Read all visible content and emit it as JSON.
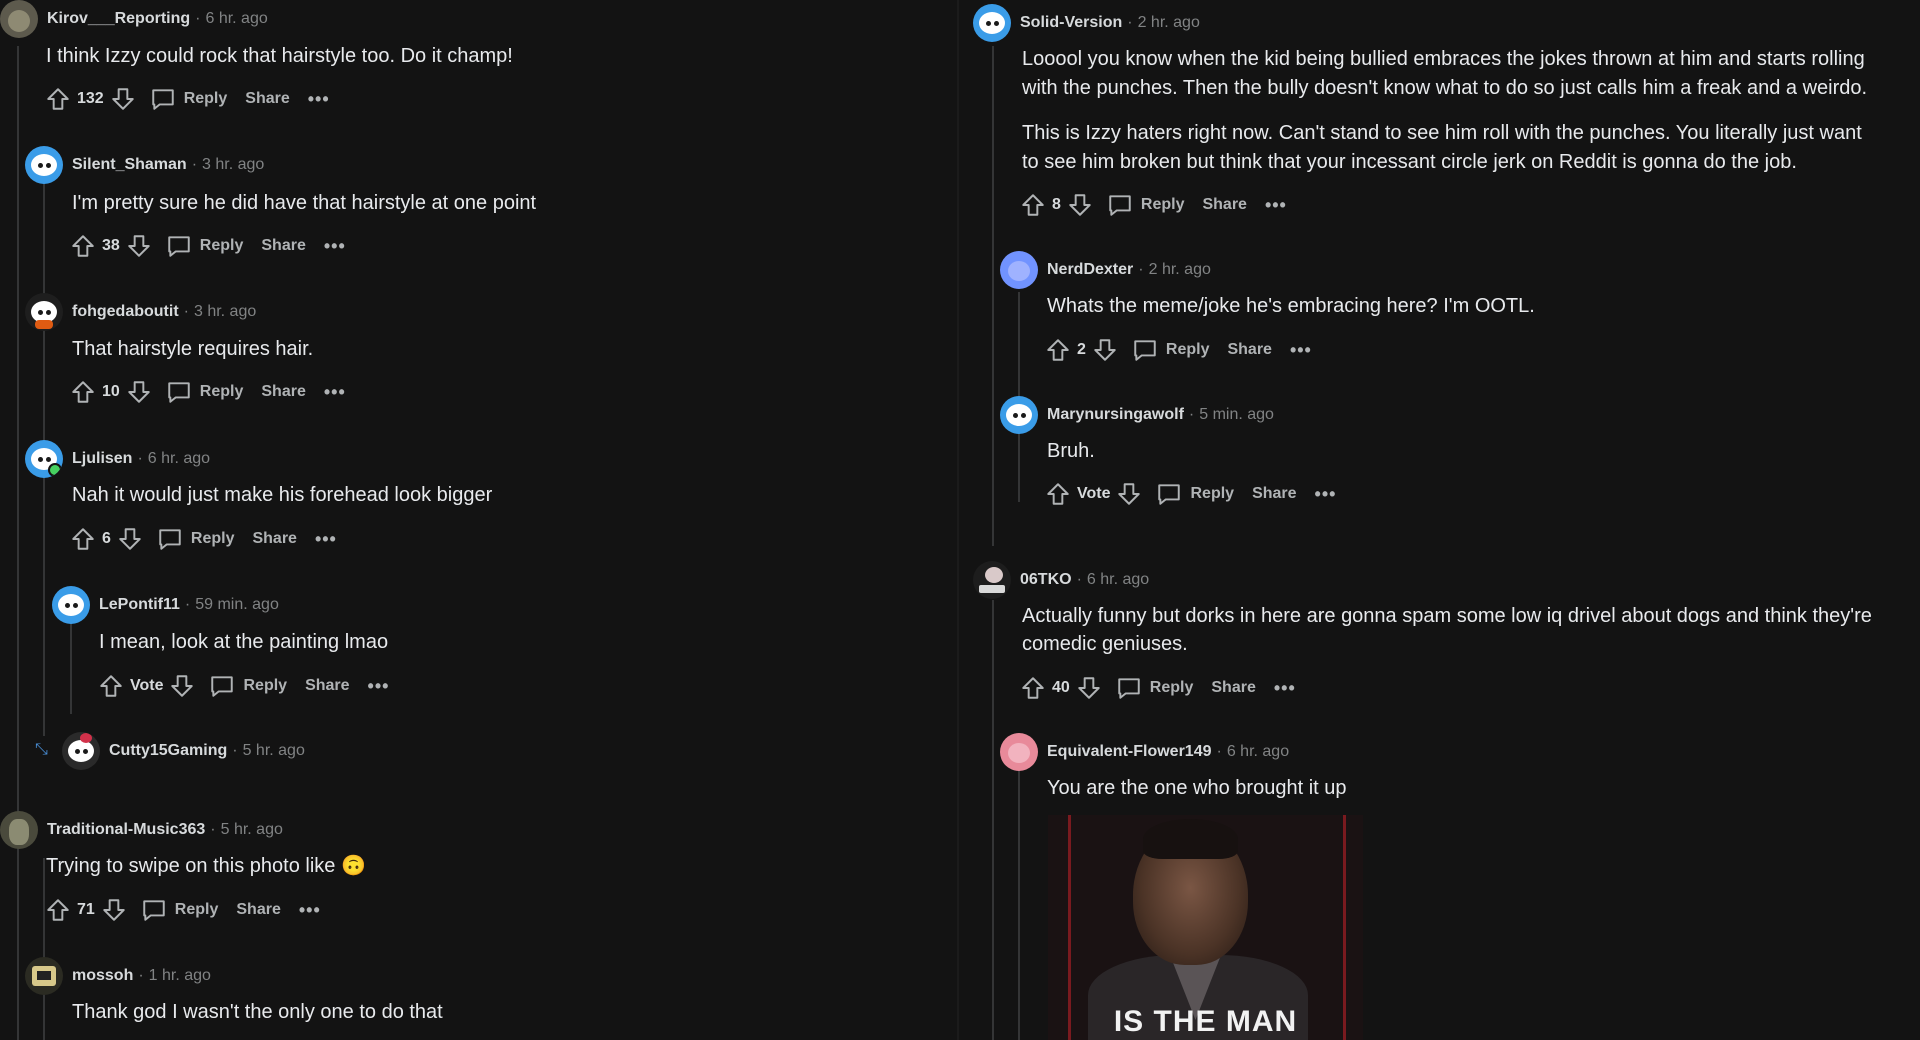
{
  "labels": {
    "reply": "Reply",
    "share": "Share",
    "more": "•••",
    "dot": "·"
  },
  "left_comments": [
    {
      "username": "Kirov___Reporting",
      "time": "6 hr. ago",
      "text": "I think Izzy could rock that hairstyle too. Do it champ!",
      "score": "132"
    },
    {
      "username": "Silent_Shaman",
      "time": "3 hr. ago",
      "text": "I'm pretty sure he did have that hairstyle at one point",
      "score": "38"
    },
    {
      "username": "fohgedaboutit",
      "time": "3 hr. ago",
      "text": "That hairstyle requires hair.",
      "score": "10"
    },
    {
      "username": "Ljulisen",
      "time": "6 hr. ago",
      "text": "Nah it would just make his forehead look bigger",
      "score": "6"
    },
    {
      "username": "LePontif11",
      "time": "59 min. ago",
      "text": "I mean, look at the painting lmao",
      "score": "Vote"
    },
    {
      "username": "Cutty15Gaming",
      "time": "5 hr. ago"
    },
    {
      "username": "Traditional-Music363",
      "time": "5 hr. ago",
      "text": "Trying to swipe on this photo like 🙃",
      "score": "71"
    },
    {
      "username": "mossoh",
      "time": "1 hr. ago",
      "text": "Thank god I wasn't the only one to do that"
    }
  ],
  "right_comments": [
    {
      "username": "Solid-Version",
      "time": "2 hr. ago",
      "text_lines": [
        "Looool you know when the kid being bullied embraces the jokes thrown at him and starts rolling",
        "with the punches. Then the bully doesn't know what to do so just calls him a freak and a weirdo.",
        "This is Izzy haters right now. Can't stand to see him roll with the punches. You literally just want",
        "to see him broken but think that your incessant circle jerk on Reddit is gonna do the job."
      ],
      "score": "8"
    },
    {
      "username": "NerdDexter",
      "time": "2 hr. ago",
      "text": "Whats the meme/joke he's embracing here? I'm OOTL.",
      "score": "2"
    },
    {
      "username": "Marynursingawolf",
      "time": "5 min. ago",
      "text": "Bruh.",
      "score": "Vote"
    },
    {
      "username": "06TKO",
      "time": "6 hr. ago",
      "text_lines": [
        "Actually funny but dorks in here are gonna spam some low iq drivel about dogs and think they're",
        "comedic geniuses."
      ],
      "score": "40"
    },
    {
      "username": "Equivalent-Flower149",
      "time": "6 hr. ago",
      "text": "You are the one who brought it up",
      "image_caption": "IS THE MAN"
    }
  ],
  "colors": {
    "background": "#131313",
    "text": "#d7dadc",
    "muted": "#818384",
    "online": "#46d160",
    "reddit_blue": "#3a9ce8"
  }
}
